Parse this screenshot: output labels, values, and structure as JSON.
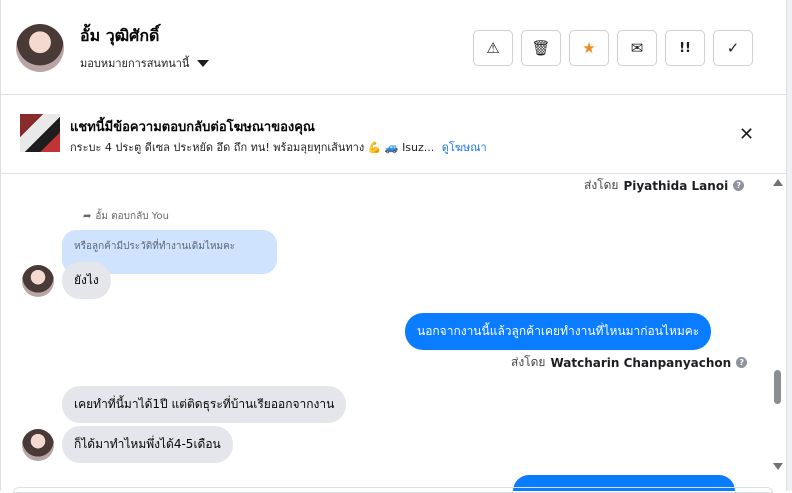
{
  "header": {
    "contact_name": "อั้ม วุฒิศักดิ์",
    "assign_label": "มอบหมายการสนทนานี้",
    "actions": [
      {
        "icon": "warning-icon",
        "glyph": "⚠"
      },
      {
        "icon": "trash-icon",
        "glyph": "🗑"
      },
      {
        "icon": "star-icon",
        "glyph": "★"
      },
      {
        "icon": "envelope-open-icon",
        "glyph": "✉"
      },
      {
        "icon": "follow-up-icon",
        "glyph": "!!"
      },
      {
        "icon": "check-icon",
        "glyph": "✓"
      }
    ]
  },
  "ad": {
    "title": "แชทนี้มีข้อความตอบกลับต่อโฆษณาของคุณ",
    "subtitle": "กระบะ 4 ประตู ดีเซล ประหยัด อึด ถึก ทน! พร้อมลุยทุกเส้นทาง 💪 🚙 Isuz...",
    "link_label": "ดูโฆษณา",
    "close_glyph": "✕"
  },
  "messages": {
    "sent_by_1_prefix": "ส่งโดย",
    "sent_by_1_name": "Piyathida Lanoi",
    "reply_note": "อั้ม ตอบกลับ You",
    "quoted_text": "หรือลูกค้ามีประวัติที่ทำงานเดิมไหมคะ",
    "msg_1": "ยังไง",
    "msg_2": "นอกจากงานนี้แล้วลูกค้าเคยทำงานที่ไหนมาก่อนไหมคะ",
    "sent_by_2_prefix": "ส่งโดย",
    "sent_by_2_name": "Watcharin Chanpanyachon",
    "msg_3": "เคยทำที่นี้มาได้1ปี แต่ติดธุระที่บ้านเรียออกจากงาน",
    "msg_4": "ก็ได้มาทำไหมพึ่งได้4-5เดือน"
  },
  "colors": {
    "outgoing_bubble": "#0a7cff",
    "incoming_bubble": "#e4e6eb",
    "quoted_bubble": "#cfe3ff",
    "star_accent": "#f28b1d",
    "link": "#1877f2"
  }
}
